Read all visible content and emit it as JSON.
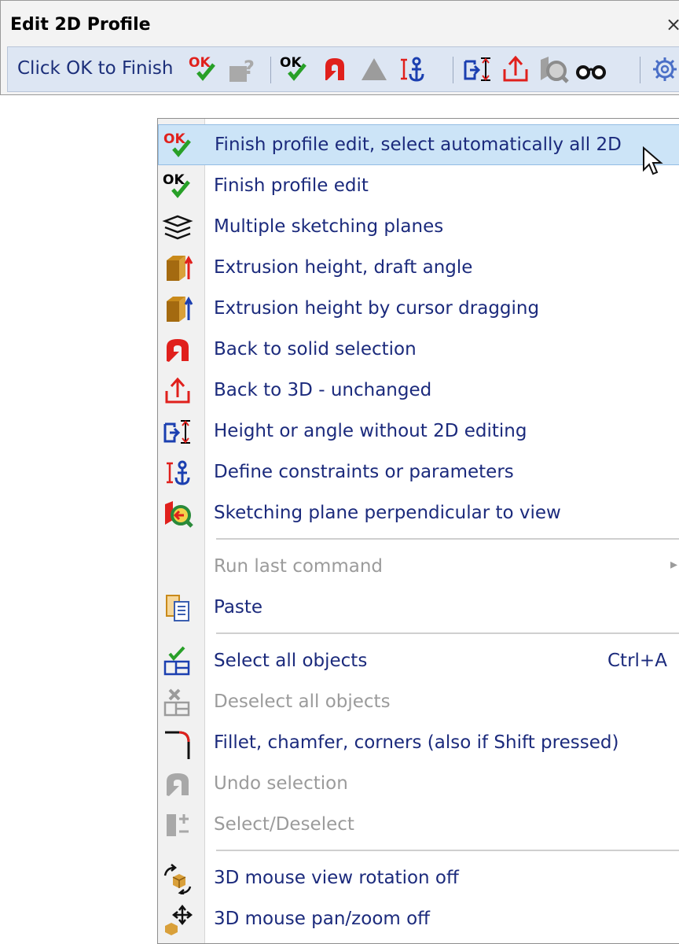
{
  "panel": {
    "title": "Edit 2D Profile",
    "close": "×",
    "hint": "Click OK to Finish",
    "icons": [
      "ok-all-icon",
      "grey-query-icon",
      "ok-icon",
      "undo-red-icon",
      "grey-triangle-icon",
      "constraint-anchor-icon",
      "height-angle-icon",
      "back-3d-icon",
      "perpendicular-plane-icon",
      "glasses-icon",
      "gear-icon"
    ]
  },
  "menu": {
    "items": [
      {
        "label": "Finish profile edit, select automatically all 2D",
        "icon": "ok-all-icon",
        "highlighted": true
      },
      {
        "label": "Finish profile edit",
        "icon": "ok-icon"
      },
      {
        "label": "Multiple sketching planes",
        "icon": "multi-plane-icon"
      },
      {
        "label": "Extrusion height, draft angle",
        "icon": "extrusion-red-icon"
      },
      {
        "label": "Extrusion height by cursor dragging",
        "icon": "extrusion-blue-icon"
      },
      {
        "label": "Back to solid selection",
        "icon": "undo-red-icon"
      },
      {
        "label": "Back to 3D - unchanged",
        "icon": "back-3d-icon"
      },
      {
        "label": "Height or angle without 2D editing",
        "icon": "height-angle-icon"
      },
      {
        "label": "Define constraints or parameters",
        "icon": "constraint-anchor-icon"
      },
      {
        "label": "Sketching plane perpendicular to view",
        "icon": "perpendicular-plane-icon"
      },
      {
        "label": "Run last command",
        "disabled": true,
        "submenu": true
      },
      {
        "label": "Paste",
        "icon": "paste-icon"
      },
      {
        "label": "Select all objects",
        "icon": "select-all-icon",
        "shortcut": "Ctrl+A"
      },
      {
        "label": "Deselect all objects",
        "icon": "deselect-all-icon",
        "disabled": true
      },
      {
        "label": "Fillet, chamfer, corners (also if Shift pressed)",
        "icon": "fillet-icon"
      },
      {
        "label": "Undo selection",
        "icon": "undo-grey-icon",
        "disabled": true
      },
      {
        "label": "Select/Deselect",
        "icon": "select-deselect-icon",
        "disabled": true
      },
      {
        "label": "3D mouse view rotation off",
        "icon": "mouse-rotate-icon"
      },
      {
        "label": "3D mouse pan/zoom off",
        "icon": "mouse-pan-icon"
      }
    ],
    "submenu_arrow": "▸"
  },
  "colors": {
    "highlight": "#cce4f7",
    "text": "#1b2a7c",
    "disabled": "#9b9b9b",
    "ok_red": "#e0201c",
    "ok_green": "#28a028"
  }
}
